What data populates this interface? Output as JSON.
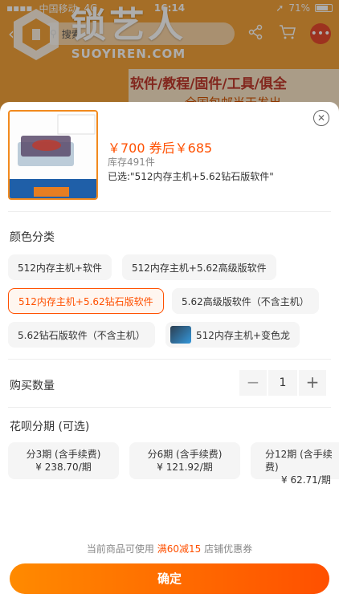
{
  "status_bar": {
    "carrier": "中国移动",
    "network": "4G",
    "time": "16:14",
    "battery": "71%"
  },
  "search": {
    "placeholder": "搜索"
  },
  "watermark": {
    "cn": "锁艺人",
    "en": "SUOYIREN.COM"
  },
  "banner": {
    "line1": "软件/教程/固件/工具/俱全",
    "line2": "全国包邮当天发出"
  },
  "product": {
    "image_caption": "Proxmark3 不成功包退",
    "price": "￥700",
    "coupon_price": "券后￥685",
    "stock": "库存491件",
    "selected": "已选:\"512内存主机+5.62钻石版软件\""
  },
  "colors": {
    "accent": "#ff5000",
    "accent_grad_start": "#ff8a00"
  },
  "variant_section": {
    "title": "颜色分类",
    "options": [
      {
        "label": "512内存主机+软件",
        "selected": false
      },
      {
        "label": "512内存主机+5.62高级版软件",
        "selected": false
      },
      {
        "label": "512内存主机+5.62钻石版软件",
        "selected": true
      },
      {
        "label": "5.62高级版软件（不含主机）",
        "selected": false
      },
      {
        "label": "5.62钻石版软件（不含主机）",
        "selected": false
      },
      {
        "label": "512内存主机+变色龙",
        "selected": false,
        "has_thumb": true
      }
    ]
  },
  "quantity": {
    "title": "购买数量",
    "value": "1",
    "minus": "−",
    "plus": "+"
  },
  "installments": {
    "title": "花呗分期 (可选)",
    "items": [
      {
        "term": "分3期 (含手续费)",
        "amount": "¥ 238.70/期"
      },
      {
        "term": "分6期 (含手续费)",
        "amount": "¥ 121.92/期"
      },
      {
        "term": "分12期 (含手续费)",
        "amount": "¥ 62.71/期"
      }
    ]
  },
  "coupon": {
    "prefix": "当前商品可使用 ",
    "highlight": "满60减15",
    "suffix": " 店铺优惠券"
  },
  "confirm": {
    "label": "确定"
  }
}
